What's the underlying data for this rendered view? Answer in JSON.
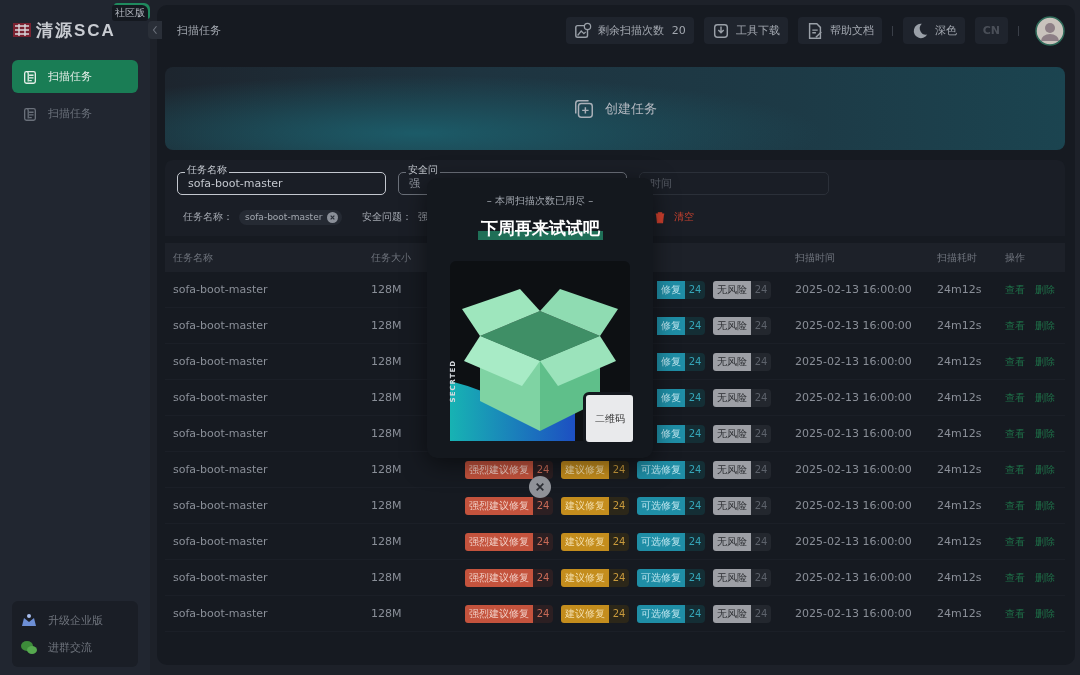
{
  "sidebar": {
    "logo": "清源SCA",
    "edition_badge": "社区版",
    "items": [
      {
        "label": "扫描任务",
        "selected": true
      },
      {
        "label": "扫描任务",
        "selected": false
      }
    ],
    "footer_items": [
      {
        "kind": "upgrade",
        "label": "升级企业版"
      },
      {
        "kind": "chat",
        "label": "进群交流"
      }
    ]
  },
  "header": {
    "title": "扫描任务",
    "actions": [
      {
        "kind": "quota",
        "label": "剩余扫描次数",
        "count": "20"
      },
      {
        "kind": "download",
        "label": "工具下载"
      },
      {
        "kind": "docs",
        "label": "帮助文档"
      },
      {
        "kind": "theme",
        "label": "深色"
      },
      {
        "kind": "language",
        "label": "CN"
      }
    ]
  },
  "banner": {
    "label": "创建任务"
  },
  "filters": {
    "fields": [
      {
        "label": "任务名称",
        "value": "sofa-boot-master"
      },
      {
        "label": "安全问",
        "value": "强"
      },
      {
        "placeholder": "时间"
      }
    ],
    "chips": [
      {
        "label": "任务名称：",
        "value": "sofa-boot-master",
        "removable": true
      },
      {
        "label": "安全问题：",
        "value": "强",
        "removable": false
      }
    ],
    "clear": "清空"
  },
  "table": {
    "columns": [
      "任务名称",
      "任务大小",
      "扫描时间",
      "扫描耗时",
      "操作"
    ],
    "rows": [
      {
        "name": "sofa-boot-master",
        "size": "128M",
        "issues": [
          {
            "kind": "optional",
            "label": "修复",
            "count": "24",
            "clipped": true
          },
          {
            "kind": "none",
            "label": "无风险",
            "count": "24"
          }
        ],
        "time": "2025-02-13 16:00:00",
        "duration": "24m12s",
        "actions": [
          "查看",
          "删除"
        ]
      },
      {
        "name": "sofa-boot-master",
        "size": "128M",
        "issues": [
          {
            "kind": "optional",
            "label": "修复",
            "count": "24",
            "clipped": true
          },
          {
            "kind": "none",
            "label": "无风险",
            "count": "24"
          }
        ],
        "time": "2025-02-13 16:00:00",
        "duration": "24m12s",
        "actions": [
          "查看",
          "删除"
        ]
      },
      {
        "name": "sofa-boot-master",
        "size": "128M",
        "issues": [
          {
            "kind": "optional",
            "label": "修复",
            "count": "24",
            "clipped": true
          },
          {
            "kind": "none",
            "label": "无风险",
            "count": "24"
          }
        ],
        "time": "2025-02-13 16:00:00",
        "duration": "24m12s",
        "actions": [
          "查看",
          "删除"
        ]
      },
      {
        "name": "sofa-boot-master",
        "size": "128M",
        "issues": [
          {
            "kind": "optional",
            "label": "修复",
            "count": "24",
            "clipped": true
          },
          {
            "kind": "none",
            "label": "无风险",
            "count": "24"
          }
        ],
        "time": "2025-02-13 16:00:00",
        "duration": "24m12s",
        "actions": [
          "查看",
          "删除"
        ]
      },
      {
        "name": "sofa-boot-master",
        "size": "128M",
        "issues": [
          {
            "kind": "optional",
            "label": "修复",
            "count": "24",
            "clipped": true
          },
          {
            "kind": "none",
            "label": "无风险",
            "count": "24"
          }
        ],
        "time": "2025-02-13 16:00:00",
        "duration": "24m12s",
        "actions": [
          "查看",
          "删除"
        ]
      },
      {
        "name": "sofa-boot-master",
        "size": "128M",
        "issues": [
          {
            "kind": "strong",
            "label": "强烈建议修复",
            "count": "24"
          },
          {
            "kind": "suggest",
            "label": "建议修复",
            "count": "24"
          },
          {
            "kind": "optional",
            "label": "可选修复",
            "count": "24"
          },
          {
            "kind": "none",
            "label": "无风险",
            "count": "24"
          }
        ],
        "time": "2025-02-13 16:00:00",
        "duration": "24m12s",
        "actions": [
          "查看",
          "删除"
        ]
      },
      {
        "name": "sofa-boot-master",
        "size": "128M",
        "issues": [
          {
            "kind": "strong",
            "label": "强烈建议修复",
            "count": "24"
          },
          {
            "kind": "suggest",
            "label": "建议修复",
            "count": "24"
          },
          {
            "kind": "optional",
            "label": "可选修复",
            "count": "24"
          },
          {
            "kind": "none",
            "label": "无风险",
            "count": "24"
          }
        ],
        "time": "2025-02-13 16:00:00",
        "duration": "24m12s",
        "actions": [
          "查看",
          "删除"
        ]
      },
      {
        "name": "sofa-boot-master",
        "size": "128M",
        "issues": [
          {
            "kind": "strong",
            "label": "强烈建议修复",
            "count": "24"
          },
          {
            "kind": "suggest",
            "label": "建议修复",
            "count": "24"
          },
          {
            "kind": "optional",
            "label": "可选修复",
            "count": "24"
          },
          {
            "kind": "none",
            "label": "无风险",
            "count": "24"
          }
        ],
        "time": "2025-02-13 16:00:00",
        "duration": "24m12s",
        "actions": [
          "查看",
          "删除"
        ]
      },
      {
        "name": "sofa-boot-master",
        "size": "128M",
        "issues": [
          {
            "kind": "strong",
            "label": "强烈建议修复",
            "count": "24"
          },
          {
            "kind": "suggest",
            "label": "建议修复",
            "count": "24"
          },
          {
            "kind": "optional",
            "label": "可选修复",
            "count": "24"
          },
          {
            "kind": "none",
            "label": "无风险",
            "count": "24"
          }
        ],
        "time": "2025-02-13 16:00:00",
        "duration": "24m12s",
        "actions": [
          "查看",
          "删除"
        ]
      },
      {
        "name": "sofa-boot-master",
        "size": "128M",
        "issues": [
          {
            "kind": "strong",
            "label": "强烈建议修复",
            "count": "24"
          },
          {
            "kind": "suggest",
            "label": "建议修复",
            "count": "24"
          },
          {
            "kind": "optional",
            "label": "可选修复",
            "count": "24"
          },
          {
            "kind": "none",
            "label": "无风险",
            "count": "24"
          }
        ],
        "time": "2025-02-13 16:00:00",
        "duration": "24m12s",
        "actions": [
          "查看",
          "删除"
        ]
      }
    ]
  },
  "modal": {
    "subtitle": "– 本周扫描次数已用尽 –",
    "title": "下周再来试试吧",
    "image_caption": "SECRTED",
    "qr_label": "二维码"
  }
}
